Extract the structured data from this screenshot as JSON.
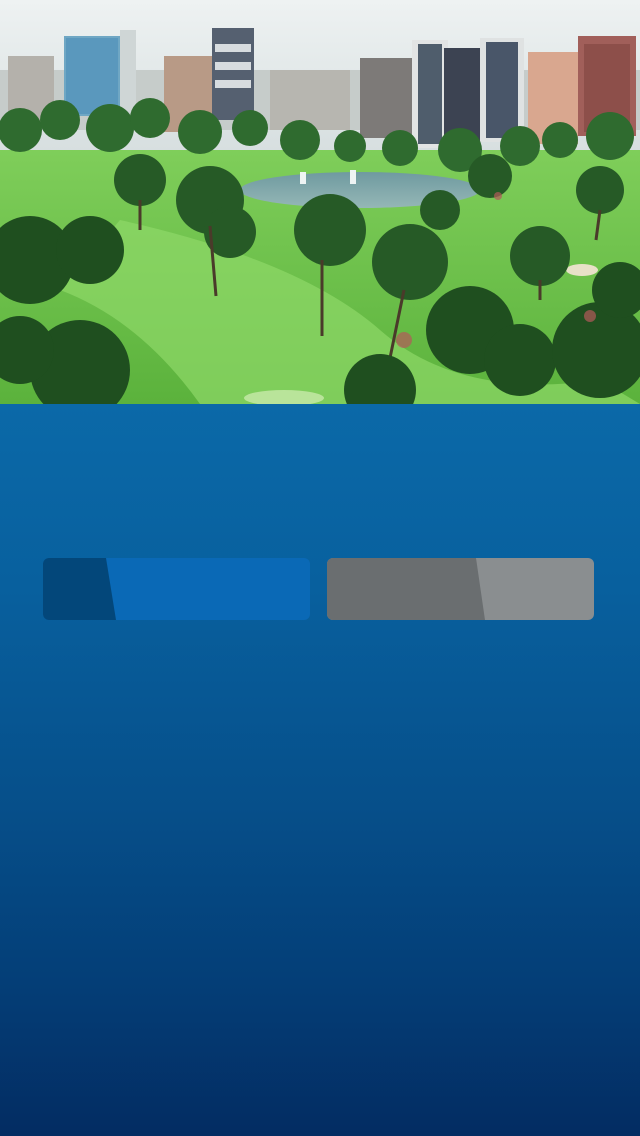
{
  "hero": {
    "image_icon": "city-park-photo-icon"
  },
  "buttons": [
    {
      "label": "",
      "accent": "#0a69b6",
      "tab_color": "#03477a"
    },
    {
      "label": "",
      "accent": "#8a8e90",
      "tab_color": "#6a6e70"
    }
  ],
  "colors": {
    "background_top": "#0b69a8",
    "background_bottom": "#032c62"
  }
}
